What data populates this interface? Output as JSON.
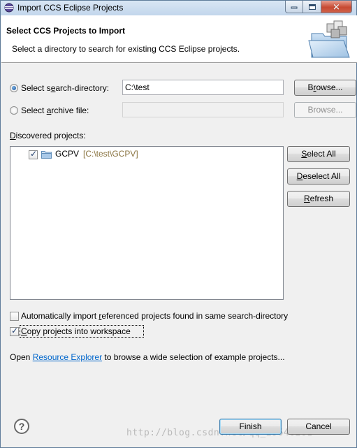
{
  "window": {
    "title": "Import CCS Eclipse Projects"
  },
  "header": {
    "title": "Select CCS Projects to Import",
    "description": "Select a directory to search for existing CCS Eclipse projects."
  },
  "source": {
    "search_directory": {
      "label_prefix": "Select s",
      "label_mnemonic": "e",
      "label_suffix": "arch-directory:",
      "selected": true,
      "value": "C:\\test",
      "browse_label_prefix": "B",
      "browse_label_mnemonic": "r",
      "browse_label_suffix": "owse..."
    },
    "archive_file": {
      "label_prefix": "Select ",
      "label_mnemonic": "a",
      "label_suffix": "rchive file:",
      "selected": false,
      "value": "",
      "browse_label": "Browse..."
    }
  },
  "discovered": {
    "label_prefix": "",
    "label_mnemonic": "D",
    "label_suffix": "iscovered projects:",
    "projects": [
      {
        "name": "GCPV",
        "path": "[C:\\test\\GCPV]",
        "checked": true
      }
    ],
    "buttons": {
      "select_all_mnemonic": "S",
      "select_all_rest": "elect All",
      "deselect_all_mnemonic": "D",
      "deselect_all_rest": "eselect All",
      "refresh_mnemonic": "R",
      "refresh_rest": "efresh"
    }
  },
  "options": {
    "auto_import_prefix": "Automatically import ",
    "auto_import_mnemonic": "r",
    "auto_import_suffix": "eferenced projects found in same search-directory",
    "auto_import_checked": false,
    "copy_label_prefix": "",
    "copy_label_mnemonic": "C",
    "copy_label_suffix": "opy projects into workspace",
    "copy_checked": true
  },
  "resource": {
    "before": "Open ",
    "link": "Resource Explorer",
    "after": " to browse a wide selection of example projects..."
  },
  "footer": {
    "finish_label": "Finish",
    "cancel_label": "Cancel"
  },
  "watermark": "http://blog.csdn.net/qq_29646261",
  "icons": [
    "eclipse-app-icon",
    "minimize-icon",
    "maximize-icon",
    "close-icon",
    "import-wizard-icon",
    "folder-icon",
    "help-icon"
  ]
}
